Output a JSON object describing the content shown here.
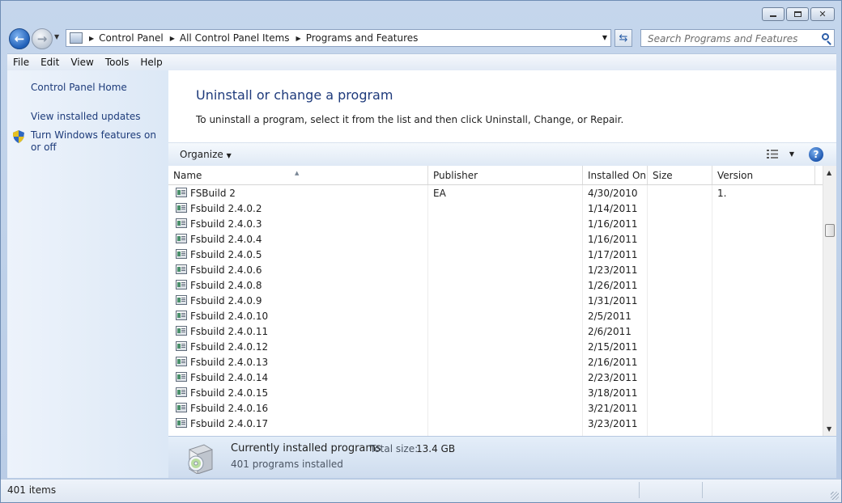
{
  "window": {
    "minimize_icon": "minimize-icon",
    "maximize_icon": "maximize-icon",
    "close_icon": "close-icon"
  },
  "navbar": {
    "breadcrumbs": [
      "Control Panel",
      "All Control Panel Items",
      "Programs and Features"
    ],
    "search_placeholder": "Search Programs and Features"
  },
  "menu": [
    "File",
    "Edit",
    "View",
    "Tools",
    "Help"
  ],
  "tasks": {
    "home": "Control Panel Home",
    "updates": "View installed updates",
    "features": "Turn Windows features on or off"
  },
  "main": {
    "title": "Uninstall or change a program",
    "subtitle": "To uninstall a program, select it from the list and then click Uninstall, Change, or Repair.",
    "organize": "Organize"
  },
  "columns": [
    "Name",
    "Publisher",
    "Installed On",
    "Size",
    "Version"
  ],
  "programs": [
    {
      "name": "FSBuild 2",
      "publisher": "EA",
      "installed": "4/30/2010",
      "size": "",
      "version": "1."
    },
    {
      "name": "Fsbuild 2.4.0.2",
      "publisher": "",
      "installed": "1/14/2011",
      "size": "",
      "version": ""
    },
    {
      "name": "Fsbuild 2.4.0.3",
      "publisher": "",
      "installed": "1/16/2011",
      "size": "",
      "version": ""
    },
    {
      "name": "Fsbuild 2.4.0.4",
      "publisher": "",
      "installed": "1/16/2011",
      "size": "",
      "version": ""
    },
    {
      "name": "Fsbuild 2.4.0.5",
      "publisher": "",
      "installed": "1/17/2011",
      "size": "",
      "version": ""
    },
    {
      "name": "Fsbuild 2.4.0.6",
      "publisher": "",
      "installed": "1/23/2011",
      "size": "",
      "version": ""
    },
    {
      "name": "Fsbuild 2.4.0.8",
      "publisher": "",
      "installed": "1/26/2011",
      "size": "",
      "version": ""
    },
    {
      "name": "Fsbuild 2.4.0.9",
      "publisher": "",
      "installed": "1/31/2011",
      "size": "",
      "version": ""
    },
    {
      "name": "Fsbuild 2.4.0.10",
      "publisher": "",
      "installed": "2/5/2011",
      "size": "",
      "version": ""
    },
    {
      "name": "Fsbuild 2.4.0.11",
      "publisher": "",
      "installed": "2/6/2011",
      "size": "",
      "version": ""
    },
    {
      "name": "Fsbuild 2.4.0.12",
      "publisher": "",
      "installed": "2/15/2011",
      "size": "",
      "version": ""
    },
    {
      "name": "Fsbuild 2.4.0.13",
      "publisher": "",
      "installed": "2/16/2011",
      "size": "",
      "version": ""
    },
    {
      "name": "Fsbuild 2.4.0.14",
      "publisher": "",
      "installed": "2/23/2011",
      "size": "",
      "version": ""
    },
    {
      "name": "Fsbuild 2.4.0.15",
      "publisher": "",
      "installed": "3/18/2011",
      "size": "",
      "version": ""
    },
    {
      "name": "Fsbuild 2.4.0.16",
      "publisher": "",
      "installed": "3/21/2011",
      "size": "",
      "version": ""
    },
    {
      "name": "Fsbuild 2.4.0.17",
      "publisher": "",
      "installed": "3/23/2011",
      "size": "",
      "version": ""
    }
  ],
  "details": {
    "title": "Currently installed programs",
    "total_label": "Total size:",
    "total_value": "13.4 GB",
    "count": "401 programs installed"
  },
  "status": {
    "items": "401 items"
  },
  "colors": {
    "link": "#1d3b7a",
    "title": "#1e3a7b",
    "frame": "#b9cce6"
  }
}
